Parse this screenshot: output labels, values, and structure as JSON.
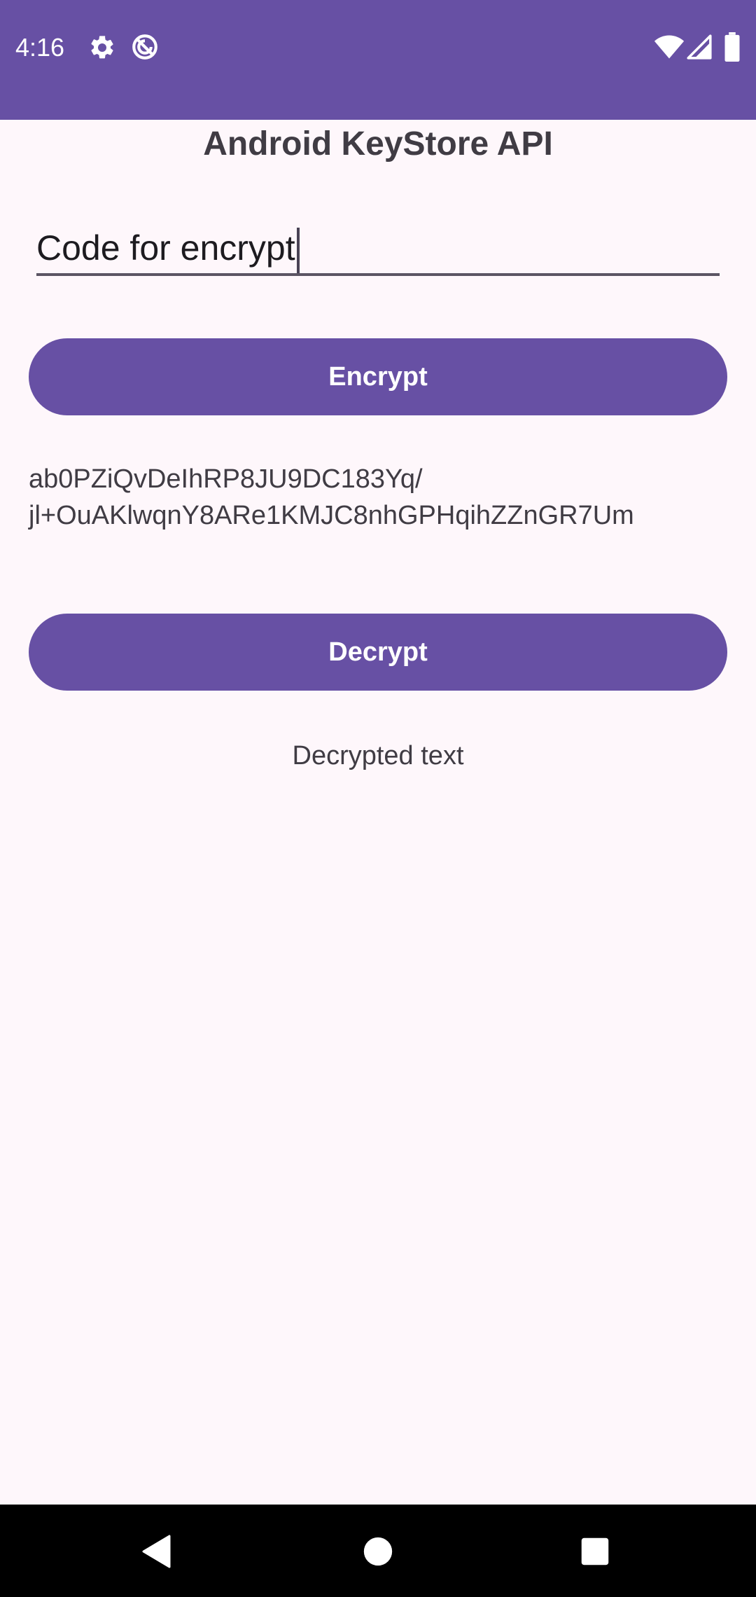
{
  "status_bar": {
    "time": "4:16",
    "background_color": "#6750a4",
    "icons": [
      "gear-icon",
      "data-saver-icon",
      "wifi-icon",
      "cell-signal-icon",
      "battery-icon"
    ]
  },
  "app": {
    "title": "Android KeyStore API",
    "input": {
      "value": "Code for encrypt",
      "placeholder": ""
    },
    "encrypt_button_label": "Encrypt",
    "encrypted_output": "ab0PZiQvDeIhRP8JU9DC183Yq/jl+OuAKlwqnY8ARe1KMJC8nhGPHqihZZnGR7Um",
    "encrypted_output_line1": "ab0PZiQvDeIhRP8JU9DC183Yq/",
    "encrypted_output_line2": "jl+OuAKlwqnY8ARe1KMJC8nhGPHqihZZnGR7Um",
    "decrypt_button_label": "Decrypt",
    "decrypted_output": "Decrypted text",
    "accent_color": "#6750a4",
    "background_color": "#fef7fb"
  },
  "nav_bar": {
    "buttons": [
      "back-icon",
      "home-icon",
      "recents-icon"
    ]
  }
}
